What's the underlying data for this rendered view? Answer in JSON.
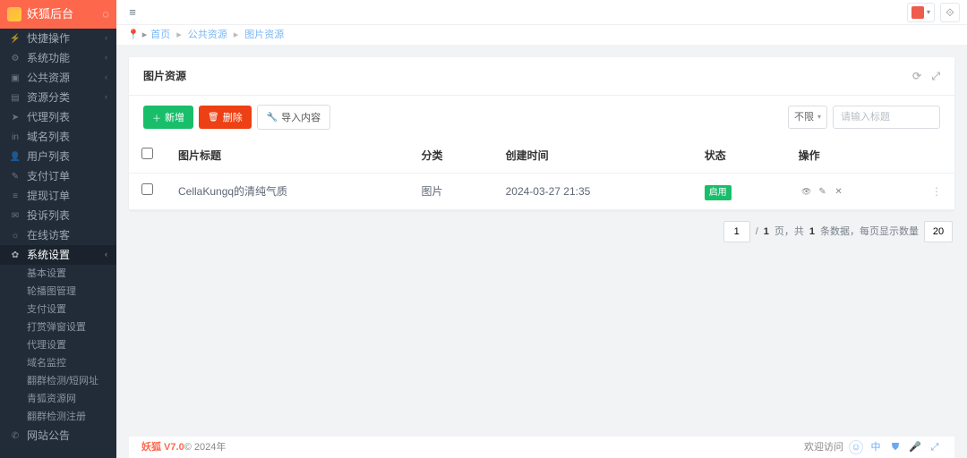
{
  "brand": {
    "name": "妖狐后台"
  },
  "sidebar": {
    "items": [
      {
        "label": "快捷操作",
        "icon": "⚡",
        "chev": true
      },
      {
        "label": "系统功能",
        "icon": "⚙",
        "chev": true
      },
      {
        "label": "公共资源",
        "icon": "▣",
        "chev": true
      },
      {
        "label": "资源分类",
        "icon": "▤",
        "chev": true
      },
      {
        "label": "代理列表",
        "icon": "➤",
        "chev": false
      },
      {
        "label": "域名列表",
        "icon": "in",
        "chev": false
      },
      {
        "label": "用户列表",
        "icon": "👤",
        "chev": false
      },
      {
        "label": "支付订单",
        "icon": "✎",
        "chev": false
      },
      {
        "label": "提现订单",
        "icon": "≡",
        "chev": false
      },
      {
        "label": "投诉列表",
        "icon": "✉",
        "chev": false
      },
      {
        "label": "在线访客",
        "icon": "☼",
        "chev": false
      },
      {
        "label": "系统设置",
        "icon": "✿",
        "chev": true,
        "active": true
      }
    ],
    "subs": [
      {
        "label": "基本设置"
      },
      {
        "label": "轮播图管理"
      },
      {
        "label": "支付设置"
      },
      {
        "label": "打赏弹窗设置"
      },
      {
        "label": "代理设置"
      },
      {
        "label": "域名监控"
      },
      {
        "label": "翻群检测/短网址"
      },
      {
        "label": "青狐资源网"
      },
      {
        "label": "翻群检测注册"
      }
    ],
    "after": [
      {
        "label": "网站公告",
        "icon": "✆"
      }
    ]
  },
  "breadcrumbs": {
    "home": "首页",
    "a": "公共资源",
    "b": "图片资源"
  },
  "card": {
    "title": "图片资源"
  },
  "toolbar": {
    "add": "新增",
    "del": "删除",
    "import": "导入内容",
    "select": "不限",
    "search_ph": "请输入标题"
  },
  "table": {
    "headers": {
      "title": "图片标题",
      "cat": "分类",
      "time": "创建时间",
      "status": "状态",
      "ops": "操作"
    },
    "rows": [
      {
        "title": "CellaKungq的清纯气质",
        "cat": "图片",
        "time": "2024-03-27 21:35",
        "status": "启用"
      }
    ]
  },
  "pager": {
    "page": "1",
    "total_pages": "1",
    "total_text_a": "页，共",
    "total_rows": "1",
    "total_text_b": "条数据，每页显示数量",
    "size": "20",
    "sep": "/ "
  },
  "footer": {
    "brand": "妖狐 V7.0",
    "copy": " © 2024年",
    "right": "欢迎访问",
    "lang": "中"
  }
}
